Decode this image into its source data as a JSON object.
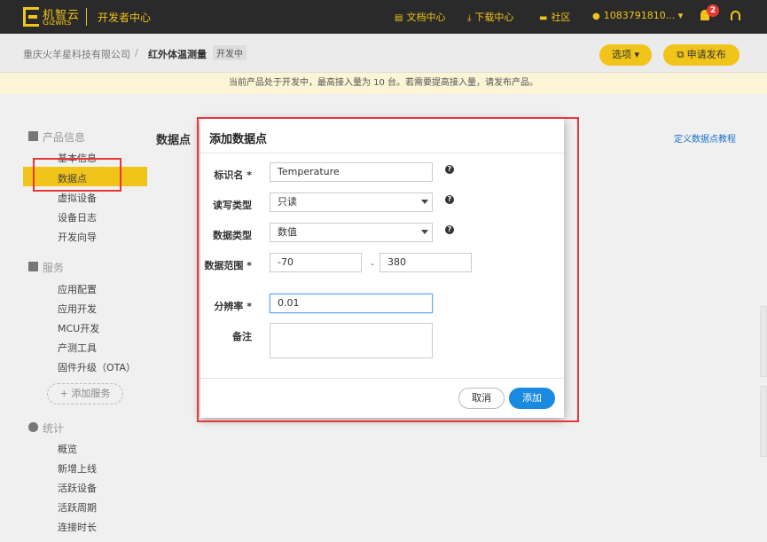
{
  "topnav": {
    "logo_cn": "机智云",
    "logo_en": "Gizwits",
    "dev_center": "开发者中心",
    "docs": "文档中心",
    "downloads": "下载中心",
    "community": "社区",
    "user": "1083791810...",
    "notification_count": "2",
    "brand_color": "#f0c419"
  },
  "breadcrumb": {
    "company": "重庆火羊星科技有限公司",
    "separator": "/",
    "product": "红外体温测量",
    "status": "开发中",
    "options_button": "选项 ▾",
    "publish_button": "申请发布"
  },
  "notice": "当前产品处于开发中，最高接入量为 10 台。若需要提高接入量，请发布产品。",
  "sidebar": {
    "sections": [
      {
        "title": "产品信息",
        "items": [
          "基本信息",
          "数据点",
          "虚拟设备",
          "设备日志",
          "开发向导"
        ]
      },
      {
        "title": "服务",
        "items": [
          "应用配置",
          "应用开发",
          "MCU开发",
          "产测工具",
          "固件升级（OTA）"
        ]
      },
      {
        "title": "统计",
        "items": [
          "概览",
          "新增上线",
          "活跃设备",
          "活跃周期",
          "连接时长"
        ]
      }
    ],
    "add_service": "+ 添加服务",
    "active_item": "数据点"
  },
  "content": {
    "title": "数据点",
    "tutorial_link": "定义数据点教程"
  },
  "modal": {
    "title": "添加数据点",
    "fields": {
      "identifier_label": "标识名 *",
      "identifier_value": "Temperature",
      "rw_label": "读写类型",
      "rw_value": "只读",
      "datatype_label": "数据类型",
      "datatype_value": "数值",
      "range_label": "数据范围 *",
      "range_min": "-70",
      "range_sep": "-",
      "range_max": "380",
      "resolution_label": "分辨率 *",
      "resolution_value": "0.01",
      "remark_label": "备注"
    },
    "cancel_button": "取消",
    "add_button": "添加"
  }
}
